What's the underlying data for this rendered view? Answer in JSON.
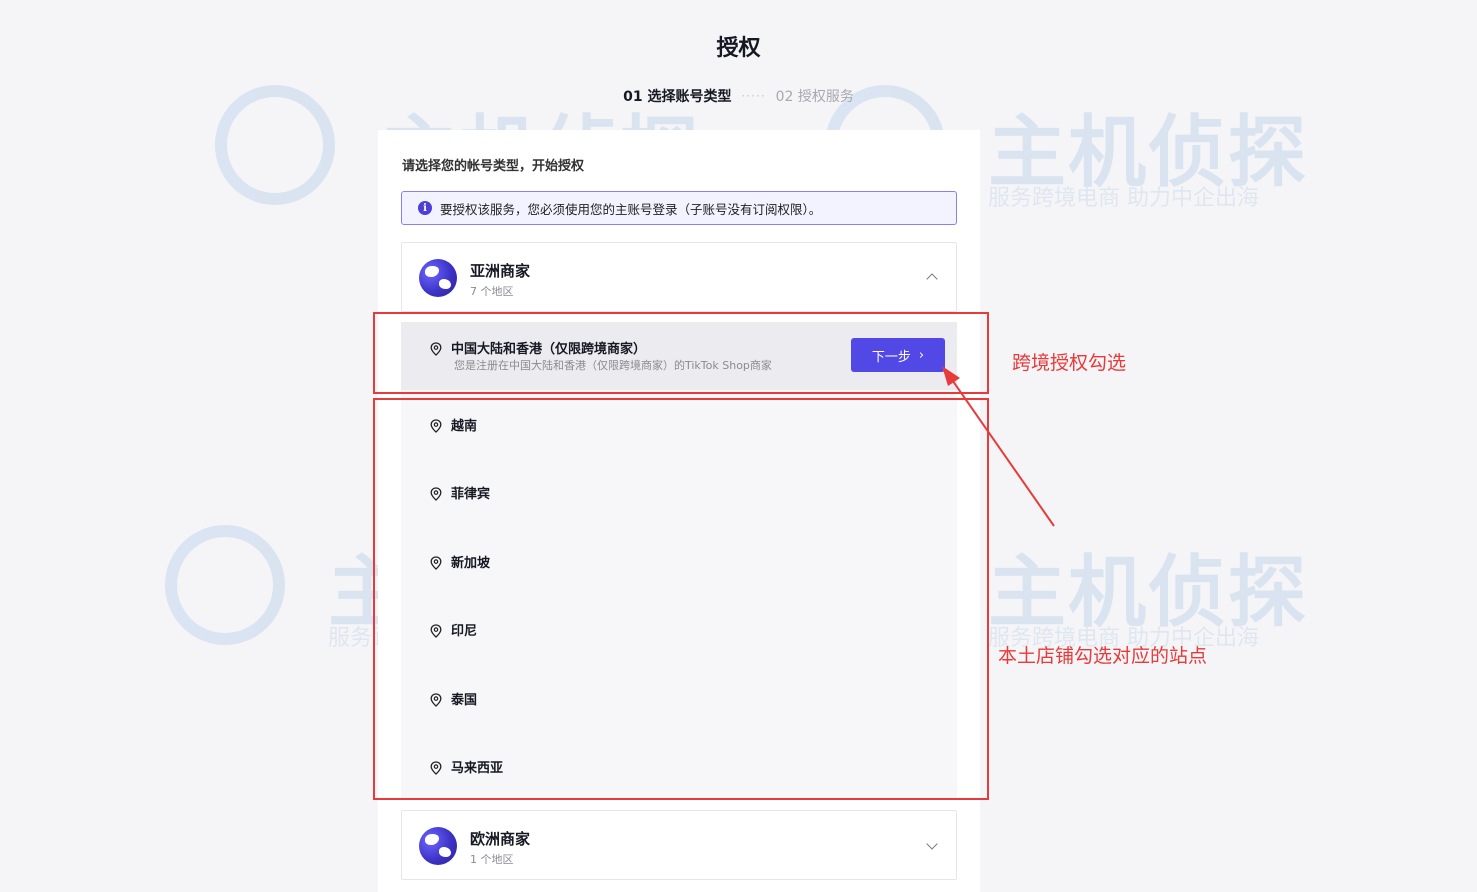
{
  "page": {
    "title": "授权"
  },
  "steps": {
    "step1": "01 选择账号类型",
    "dots": "·····",
    "step2": "02 授权服务"
  },
  "instruction": "请选择您的帐号类型，开始授权",
  "notice": {
    "icon": "info-icon",
    "text": "要授权该服务，您必须使用您的主账号登录（子账号没有订阅权限）。"
  },
  "groups": {
    "asia": {
      "name": "亚洲商家",
      "sub": "7 个地区",
      "expanded": true
    },
    "europe": {
      "name": "欧洲商家",
      "sub": "1 个地区",
      "expanded": false
    }
  },
  "regions": [
    {
      "name": "中国大陆和香港（仅限跨境商家）",
      "desc": "您是注册在中国大陆和香港（仅限跨境商家）的TikTok Shop商家",
      "selected": true
    },
    {
      "name": "越南"
    },
    {
      "name": "菲律宾"
    },
    {
      "name": "新加坡"
    },
    {
      "name": "印尼"
    },
    {
      "name": "泰国"
    },
    {
      "name": "马来西亚"
    }
  ],
  "next_button": {
    "label": "下一步",
    "chevron": "›"
  },
  "annotations": {
    "cross_border": "跨境授权勾选",
    "local": "本土店铺勾选对应的站点"
  },
  "watermark": {
    "main": "主机侦探",
    "sub": "服务跨境电商 助力中企出海"
  },
  "colors": {
    "accent": "#5148e6",
    "annotation": "#e83a3a"
  }
}
